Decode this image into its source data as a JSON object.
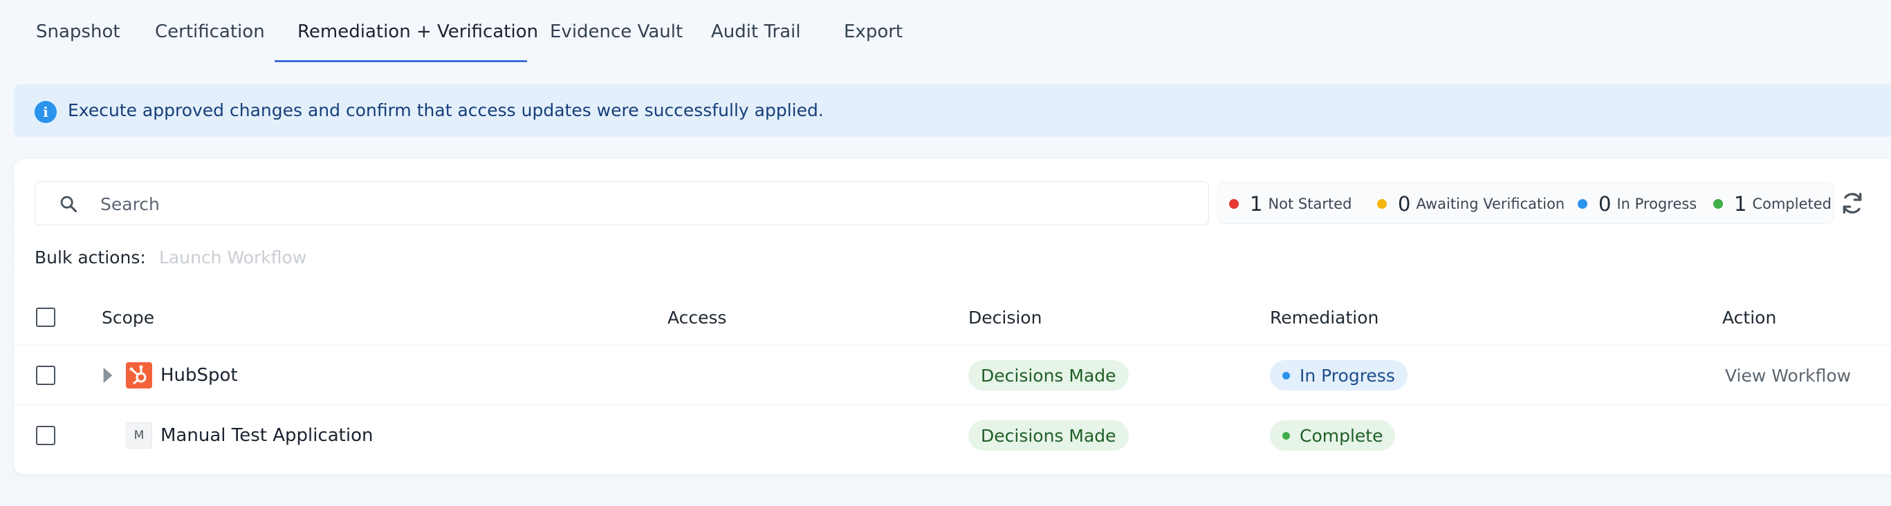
{
  "tabs": [
    {
      "label": "Snapshot",
      "active": false
    },
    {
      "label": "Certification",
      "active": false
    },
    {
      "label": "Remediation + Verification",
      "active": true
    },
    {
      "label": "Evidence Vault",
      "active": false
    },
    {
      "label": "Audit Trail",
      "active": false
    },
    {
      "label": "Export",
      "active": false
    }
  ],
  "banner": {
    "icon": "info-icon",
    "text": "Execute approved changes and confirm that access updates were successfully applied."
  },
  "search": {
    "placeholder": "Search",
    "value": ""
  },
  "status_summary": [
    {
      "count": "1",
      "label": "Not Started",
      "color": "#e53935"
    },
    {
      "count": "0",
      "label": "Awaiting Verification",
      "color": "#f6b511"
    },
    {
      "count": "0",
      "label": "In Progress",
      "color": "#2a93ec"
    },
    {
      "count": "1",
      "label": "Completed",
      "color": "#3fae4a"
    }
  ],
  "bulk_actions": {
    "label": "Bulk actions:",
    "launch_workflow": "Launch Workflow"
  },
  "table": {
    "columns": [
      "Scope",
      "Access",
      "Decision",
      "Remediation",
      "Action"
    ],
    "rows": [
      {
        "scope": "HubSpot",
        "logo": "hubspot-logo",
        "access": "",
        "decision": "Decisions Made",
        "remediation": "In Progress",
        "remediation_color": "#2a93ec",
        "action": "View Workflow"
      },
      {
        "scope": "Manual Test Application",
        "logo": "M",
        "access": "",
        "decision": "Decisions Made",
        "remediation": "Complete",
        "remediation_color": "#3fae4a",
        "action": ""
      }
    ]
  }
}
